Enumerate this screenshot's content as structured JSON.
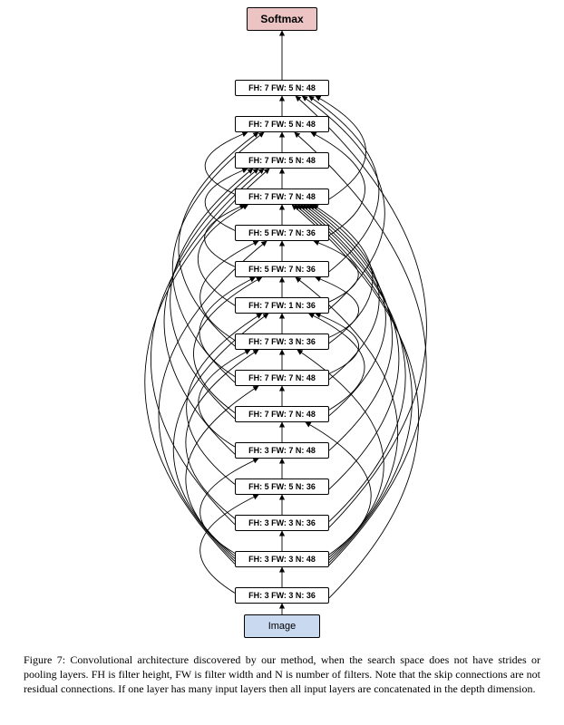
{
  "nodes": {
    "softmax": {
      "label": "Softmax"
    },
    "image": {
      "label": "Image"
    },
    "layers": [
      {
        "label": "FH: 3 FW: 3 N: 36"
      },
      {
        "label": "FH: 3 FW: 3 N: 48"
      },
      {
        "label": "FH: 3 FW: 3 N: 36"
      },
      {
        "label": "FH: 5 FW: 5 N: 36"
      },
      {
        "label": "FH: 3 FW: 7 N: 48"
      },
      {
        "label": "FH: 7 FW: 7 N: 48"
      },
      {
        "label": "FH: 7 FW: 7 N: 48"
      },
      {
        "label": "FH: 7 FW: 3 N: 36"
      },
      {
        "label": "FH: 7 FW: 1 N: 36"
      },
      {
        "label": "FH: 5 FW: 7 N: 36"
      },
      {
        "label": "FH: 5 FW: 7 N: 36"
      },
      {
        "label": "FH: 7 FW: 7 N: 48"
      },
      {
        "label": "FH: 7 FW: 5 N: 48"
      },
      {
        "label": "FH: 7 FW: 5 N: 48"
      },
      {
        "label": "FH: 7 FW: 5 N: 48"
      }
    ]
  },
  "caption_prefix": "Figure 7:",
  "caption_body": "Convolutional architecture discovered by our method, when the search space does not have strides or pooling layers. FH is filter height, FW is filter width and N is number of filters. Note that the skip connections are not residual connections. If one layer has many input layers then all input layers are concatenated in the depth dimension.",
  "chart_data": {
    "type": "diagram",
    "direction": "bottom-to-top",
    "nodes": [
      {
        "id": "image",
        "label": "Image",
        "kind": "input"
      },
      {
        "id": "L0",
        "label": "FH: 3 FW: 3 N: 36",
        "kind": "conv",
        "FH": 3,
        "FW": 3,
        "N": 36
      },
      {
        "id": "L1",
        "label": "FH: 3 FW: 3 N: 48",
        "kind": "conv",
        "FH": 3,
        "FW": 3,
        "N": 48
      },
      {
        "id": "L2",
        "label": "FH: 3 FW: 3 N: 36",
        "kind": "conv",
        "FH": 3,
        "FW": 3,
        "N": 36
      },
      {
        "id": "L3",
        "label": "FH: 5 FW: 5 N: 36",
        "kind": "conv",
        "FH": 5,
        "FW": 5,
        "N": 36
      },
      {
        "id": "L4",
        "label": "FH: 3 FW: 7 N: 48",
        "kind": "conv",
        "FH": 3,
        "FW": 7,
        "N": 48
      },
      {
        "id": "L5",
        "label": "FH: 7 FW: 7 N: 48",
        "kind": "conv",
        "FH": 7,
        "FW": 7,
        "N": 48
      },
      {
        "id": "L6",
        "label": "FH: 7 FW: 7 N: 48",
        "kind": "conv",
        "FH": 7,
        "FW": 7,
        "N": 48
      },
      {
        "id": "L7",
        "label": "FH: 7 FW: 3 N: 36",
        "kind": "conv",
        "FH": 7,
        "FW": 3,
        "N": 36
      },
      {
        "id": "L8",
        "label": "FH: 7 FW: 1 N: 36",
        "kind": "conv",
        "FH": 7,
        "FW": 1,
        "N": 36
      },
      {
        "id": "L9",
        "label": "FH: 5 FW: 7 N: 36",
        "kind": "conv",
        "FH": 5,
        "FW": 7,
        "N": 36
      },
      {
        "id": "L10",
        "label": "FH: 5 FW: 7 N: 36",
        "kind": "conv",
        "FH": 5,
        "FW": 7,
        "N": 36
      },
      {
        "id": "L11",
        "label": "FH: 7 FW: 7 N: 48",
        "kind": "conv",
        "FH": 7,
        "FW": 7,
        "N": 48
      },
      {
        "id": "L12",
        "label": "FH: 7 FW: 5 N: 48",
        "kind": "conv",
        "FH": 7,
        "FW": 5,
        "N": 48
      },
      {
        "id": "L13",
        "label": "FH: 7 FW: 5 N: 48",
        "kind": "conv",
        "FH": 7,
        "FW": 5,
        "N": 48
      },
      {
        "id": "L14",
        "label": "FH: 7 FW: 5 N: 48",
        "kind": "conv",
        "FH": 7,
        "FW": 5,
        "N": 48
      },
      {
        "id": "softmax",
        "label": "Softmax",
        "kind": "output"
      }
    ],
    "edges": [
      [
        "image",
        "L0"
      ],
      [
        "L0",
        "L1"
      ],
      [
        "L1",
        "L2"
      ],
      [
        "L2",
        "L3"
      ],
      [
        "L3",
        "L4"
      ],
      [
        "L4",
        "L5"
      ],
      [
        "L5",
        "L6"
      ],
      [
        "L6",
        "L7"
      ],
      [
        "L7",
        "L8"
      ],
      [
        "L8",
        "L9"
      ],
      [
        "L9",
        "L10"
      ],
      [
        "L10",
        "L11"
      ],
      [
        "L11",
        "L12"
      ],
      [
        "L12",
        "L13"
      ],
      [
        "L13",
        "L14"
      ],
      [
        "L14",
        "softmax"
      ],
      [
        "L0",
        "L3"
      ],
      [
        "L0",
        "L11"
      ],
      [
        "L1",
        "L4"
      ],
      [
        "L1",
        "L5"
      ],
      [
        "L1",
        "L6"
      ],
      [
        "L1",
        "L7"
      ],
      [
        "L1",
        "L8"
      ],
      [
        "L1",
        "L9"
      ],
      [
        "L1",
        "L10"
      ],
      [
        "L1",
        "L11"
      ],
      [
        "L1",
        "L12"
      ],
      [
        "L1",
        "L13"
      ],
      [
        "L2",
        "L7"
      ],
      [
        "L2",
        "L11"
      ],
      [
        "L2",
        "L12"
      ],
      [
        "L2",
        "L14"
      ],
      [
        "L3",
        "L8"
      ],
      [
        "L3",
        "L11"
      ],
      [
        "L4",
        "L7"
      ],
      [
        "L4",
        "L11"
      ],
      [
        "L4",
        "L12"
      ],
      [
        "L5",
        "L8"
      ],
      [
        "L5",
        "L9"
      ],
      [
        "L5",
        "L11"
      ],
      [
        "L5",
        "L12"
      ],
      [
        "L6",
        "L8"
      ],
      [
        "L6",
        "L9"
      ],
      [
        "L6",
        "L11"
      ],
      [
        "L6",
        "L13"
      ],
      [
        "L7",
        "L9"
      ],
      [
        "L7",
        "L10"
      ],
      [
        "L7",
        "L11"
      ],
      [
        "L7",
        "L13"
      ],
      [
        "L8",
        "L10"
      ],
      [
        "L8",
        "L11"
      ],
      [
        "L8",
        "L14"
      ],
      [
        "L9",
        "L11"
      ],
      [
        "L9",
        "L14"
      ],
      [
        "L10",
        "L12"
      ],
      [
        "L10",
        "L13"
      ],
      [
        "L11",
        "L13"
      ],
      [
        "L11",
        "L14"
      ]
    ]
  },
  "layout": {
    "centerX": 311,
    "layerBoxW": 104,
    "layerBoxH": 18,
    "softmaxY": 8,
    "imageY": 678,
    "layerTopY": 648,
    "layerSpacing": 40
  }
}
